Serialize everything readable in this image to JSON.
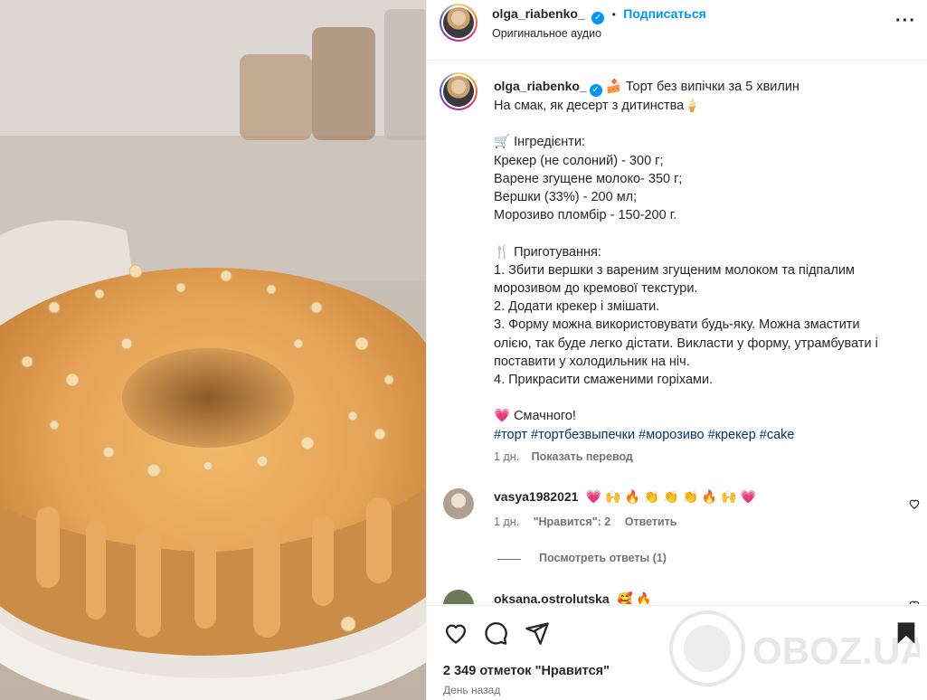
{
  "post": {
    "username": "olga_riabenko_",
    "separator": "•",
    "follow_label": "Подписаться",
    "audio": "Оригинальное аудио",
    "caption_title": "🍰 Торт без випічки за 5 хвилин",
    "caption_body": "На смак, як десерт з дитинства🍦\n\n🛒 Інгредієнти:\nКрекер (не солоний) - 300 г;\nВарене згущене молоко- 350 г;\nВершки (33%) - 200 мл;\nМорозиво пломбір - 150-200 г.\n\n🍴 Приготування:\n1. Збити вершки з вареним згущеним молоком та підпалим\nморозивом до кремової текстури.\n2. Додати крекер і змішати.\n3. Форму можна використовувати будь-яку. Можна змастити\nолією, так буде легко дістати. Викласти у форму, утрамбувати і\nпоставити у холодильник на ніч.\n4. Прикрасити смаженими горіхами.\n\n💗 Смачного!",
    "hashtags": "#торт #тортбезвыпечки #морозиво #крекер #cake",
    "time": "1 дн.",
    "translate": "Показать перевод"
  },
  "comments": [
    {
      "username": "vasya1982021",
      "text": "💗 🙌 🔥 👏 👏 👏 🔥 🙌 💗",
      "time": "1 дн.",
      "likes": "\"Нравится\": 2",
      "reply": "Ответить",
      "view_replies": "Посмотреть ответы (1)"
    },
    {
      "username": "oksana.ostrolutska",
      "text": "🥰 🔥"
    }
  ],
  "footer": {
    "likes": "2 349 отметок \"Нравится\"",
    "ago": "День назад"
  },
  "watermark": "OBOZ.UA",
  "colors": {
    "accent": "#0095f6",
    "hashtag": "#00376b",
    "muted": "#737373"
  }
}
